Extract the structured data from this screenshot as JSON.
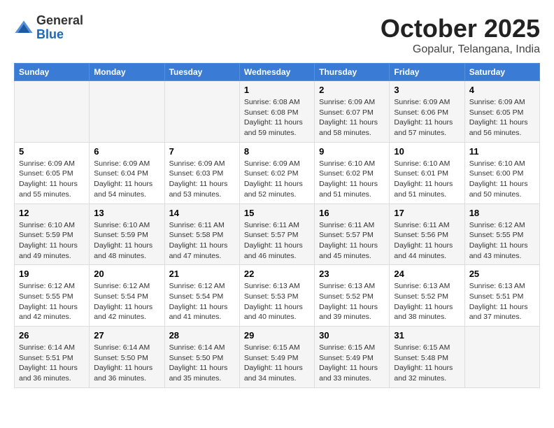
{
  "header": {
    "logo_general": "General",
    "logo_blue": "Blue",
    "month": "October 2025",
    "location": "Gopalur, Telangana, India"
  },
  "days_of_week": [
    "Sunday",
    "Monday",
    "Tuesday",
    "Wednesday",
    "Thursday",
    "Friday",
    "Saturday"
  ],
  "weeks": [
    [
      {
        "day": "",
        "info": ""
      },
      {
        "day": "",
        "info": ""
      },
      {
        "day": "",
        "info": ""
      },
      {
        "day": "1",
        "info": "Sunrise: 6:08 AM\nSunset: 6:08 PM\nDaylight: 11 hours and 59 minutes."
      },
      {
        "day": "2",
        "info": "Sunrise: 6:09 AM\nSunset: 6:07 PM\nDaylight: 11 hours and 58 minutes."
      },
      {
        "day": "3",
        "info": "Sunrise: 6:09 AM\nSunset: 6:06 PM\nDaylight: 11 hours and 57 minutes."
      },
      {
        "day": "4",
        "info": "Sunrise: 6:09 AM\nSunset: 6:05 PM\nDaylight: 11 hours and 56 minutes."
      }
    ],
    [
      {
        "day": "5",
        "info": "Sunrise: 6:09 AM\nSunset: 6:05 PM\nDaylight: 11 hours and 55 minutes."
      },
      {
        "day": "6",
        "info": "Sunrise: 6:09 AM\nSunset: 6:04 PM\nDaylight: 11 hours and 54 minutes."
      },
      {
        "day": "7",
        "info": "Sunrise: 6:09 AM\nSunset: 6:03 PM\nDaylight: 11 hours and 53 minutes."
      },
      {
        "day": "8",
        "info": "Sunrise: 6:09 AM\nSunset: 6:02 PM\nDaylight: 11 hours and 52 minutes."
      },
      {
        "day": "9",
        "info": "Sunrise: 6:10 AM\nSunset: 6:02 PM\nDaylight: 11 hours and 51 minutes."
      },
      {
        "day": "10",
        "info": "Sunrise: 6:10 AM\nSunset: 6:01 PM\nDaylight: 11 hours and 51 minutes."
      },
      {
        "day": "11",
        "info": "Sunrise: 6:10 AM\nSunset: 6:00 PM\nDaylight: 11 hours and 50 minutes."
      }
    ],
    [
      {
        "day": "12",
        "info": "Sunrise: 6:10 AM\nSunset: 5:59 PM\nDaylight: 11 hours and 49 minutes."
      },
      {
        "day": "13",
        "info": "Sunrise: 6:10 AM\nSunset: 5:59 PM\nDaylight: 11 hours and 48 minutes."
      },
      {
        "day": "14",
        "info": "Sunrise: 6:11 AM\nSunset: 5:58 PM\nDaylight: 11 hours and 47 minutes."
      },
      {
        "day": "15",
        "info": "Sunrise: 6:11 AM\nSunset: 5:57 PM\nDaylight: 11 hours and 46 minutes."
      },
      {
        "day": "16",
        "info": "Sunrise: 6:11 AM\nSunset: 5:57 PM\nDaylight: 11 hours and 45 minutes."
      },
      {
        "day": "17",
        "info": "Sunrise: 6:11 AM\nSunset: 5:56 PM\nDaylight: 11 hours and 44 minutes."
      },
      {
        "day": "18",
        "info": "Sunrise: 6:12 AM\nSunset: 5:55 PM\nDaylight: 11 hours and 43 minutes."
      }
    ],
    [
      {
        "day": "19",
        "info": "Sunrise: 6:12 AM\nSunset: 5:55 PM\nDaylight: 11 hours and 42 minutes."
      },
      {
        "day": "20",
        "info": "Sunrise: 6:12 AM\nSunset: 5:54 PM\nDaylight: 11 hours and 42 minutes."
      },
      {
        "day": "21",
        "info": "Sunrise: 6:12 AM\nSunset: 5:54 PM\nDaylight: 11 hours and 41 minutes."
      },
      {
        "day": "22",
        "info": "Sunrise: 6:13 AM\nSunset: 5:53 PM\nDaylight: 11 hours and 40 minutes."
      },
      {
        "day": "23",
        "info": "Sunrise: 6:13 AM\nSunset: 5:52 PM\nDaylight: 11 hours and 39 minutes."
      },
      {
        "day": "24",
        "info": "Sunrise: 6:13 AM\nSunset: 5:52 PM\nDaylight: 11 hours and 38 minutes."
      },
      {
        "day": "25",
        "info": "Sunrise: 6:13 AM\nSunset: 5:51 PM\nDaylight: 11 hours and 37 minutes."
      }
    ],
    [
      {
        "day": "26",
        "info": "Sunrise: 6:14 AM\nSunset: 5:51 PM\nDaylight: 11 hours and 36 minutes."
      },
      {
        "day": "27",
        "info": "Sunrise: 6:14 AM\nSunset: 5:50 PM\nDaylight: 11 hours and 36 minutes."
      },
      {
        "day": "28",
        "info": "Sunrise: 6:14 AM\nSunset: 5:50 PM\nDaylight: 11 hours and 35 minutes."
      },
      {
        "day": "29",
        "info": "Sunrise: 6:15 AM\nSunset: 5:49 PM\nDaylight: 11 hours and 34 minutes."
      },
      {
        "day": "30",
        "info": "Sunrise: 6:15 AM\nSunset: 5:49 PM\nDaylight: 11 hours and 33 minutes."
      },
      {
        "day": "31",
        "info": "Sunrise: 6:15 AM\nSunset: 5:48 PM\nDaylight: 11 hours and 32 minutes."
      },
      {
        "day": "",
        "info": ""
      }
    ]
  ]
}
